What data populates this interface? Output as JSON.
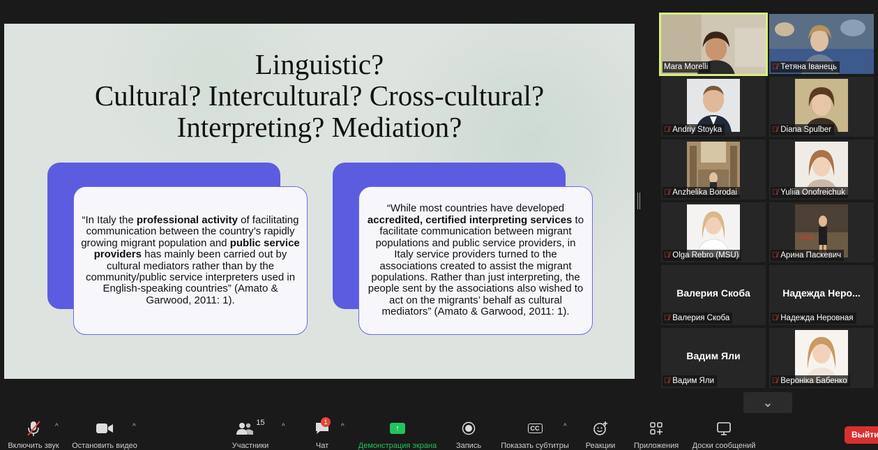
{
  "slide": {
    "title_lines": [
      "Linguistic?",
      "Cultural? Intercultural? Cross-cultural?",
      "Interpreting? Mediation?"
    ],
    "quote1": {
      "p1": "“In Italy the ",
      "b1": "professional activity",
      "p2": " of facilitating communication between the country’s rapidly growing migrant population and ",
      "b2": "public service providers",
      "p3": " has mainly been carried out by cultural mediators rather than by the community/public service interpreters used in English-speaking countries” (Amato & Garwood, 2011: 1)."
    },
    "quote2": {
      "p1": "“While most countries have developed ",
      "b1": "accredited, certified interpreting services",
      "p2": " to facilitate communication between migrant populations and public service providers, in Italy service providers turned to the associations created to assist the migrant populations. Rather than just interpreting, the people sent by the associations also wished to act on the migrants’ behalf as cultural mediators” (Amato & Garwood, 2011: 1)."
    }
  },
  "participants": [
    {
      "name": "Mara Morelli",
      "muted": false,
      "active": true
    },
    {
      "name": "Тетяна Іванець",
      "muted": true
    },
    {
      "name": "Andriy Stoyka",
      "muted": true
    },
    {
      "name": "Diana Spulber",
      "muted": true
    },
    {
      "name": "Anzhelika Borodai",
      "muted": true
    },
    {
      "name": "Yuliia Onofreichuk",
      "muted": true
    },
    {
      "name": "Olga Rebro (MSU)",
      "muted": true
    },
    {
      "name": "Арина Паскевич",
      "muted": true
    },
    {
      "name": "Валерия Скоба",
      "big": "Валерия Скоба",
      "muted": true
    },
    {
      "name": "Надежда Неровная",
      "big": "Надежда  Неро...",
      "muted": true
    },
    {
      "name": "Вадим Яли",
      "big": "Вадим Яли",
      "muted": true
    },
    {
      "name": "Вероніка Бабенко",
      "muted": true
    }
  ],
  "toolbar": {
    "unmute": "Включить звук",
    "start_video": "Остановить видео",
    "participants": "Участники",
    "participants_count": "15",
    "chat": "Чат",
    "chat_badge": "1",
    "share": "Демонстрация экрана",
    "record": "Запись",
    "captions": "Показать субтитры",
    "cc": "CC",
    "reactions": "Реакции",
    "apps": "Приложения",
    "whiteboards": "Доски сообщений",
    "leave": "Выйти"
  },
  "colors": {
    "accent_card": "#5b5ce0",
    "active_speaker": "#d8f07a",
    "share_green": "#22c35d",
    "leave_red": "#d92f2f",
    "mic_off": "#e5463b"
  }
}
